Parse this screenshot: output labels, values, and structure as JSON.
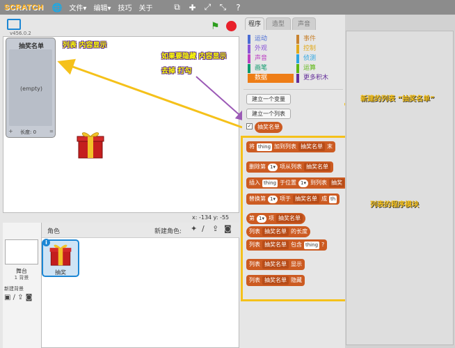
{
  "topbar": {
    "logo": "SCRATCH",
    "menus": [
      "文件▾",
      "编辑▾",
      "技巧",
      "关于"
    ]
  },
  "stage": {
    "version": "v456.0.2",
    "monitor": {
      "title": "抽奖名单",
      "empty": "(empty)",
      "plus": "+",
      "length_label": "长度: 0"
    },
    "coords": "x: -134  y: -55"
  },
  "annotations": {
    "list_content": "列表 内容显示",
    "hide_line1": "如果要隐藏 内容显示",
    "hide_line2": "去掉 打勾",
    "new_list": "新建的列表 “抽奖名单”",
    "list_blocks": "列表的程序模块"
  },
  "sprites": {
    "header_label": "角色",
    "new_sprite_label": "新建角色:",
    "stage_label": "舞台",
    "stage_bg_count": "1 背景",
    "new_backdrop": "新建背景",
    "sprite_name": "抽奖",
    "info": "i"
  },
  "palette": {
    "tabs": [
      "程序",
      "造型",
      "声音"
    ],
    "categories_left": [
      {
        "label": "运动",
        "color": "#4a6cd4"
      },
      {
        "label": "外观",
        "color": "#8a55d7"
      },
      {
        "label": "声音",
        "color": "#bb42c3"
      },
      {
        "label": "画笔",
        "color": "#0e9a6c"
      },
      {
        "label": "数据",
        "color": "#ee7d16"
      }
    ],
    "categories_right": [
      {
        "label": "事件",
        "color": "#c88330"
      },
      {
        "label": "控制",
        "color": "#e1a91a"
      },
      {
        "label": "侦测",
        "color": "#2ca5e2"
      },
      {
        "label": "运算",
        "color": "#5cb712"
      },
      {
        "label": "更多积木",
        "color": "#632d99"
      }
    ],
    "make_variable": "建立一个变量",
    "make_list": "建立一个列表",
    "list_name": "抽奖名单",
    "blocks": {
      "add": {
        "a": "将",
        "b": "thing",
        "c": "加到列表",
        "d": "抽奖名单",
        "e": "末"
      },
      "delete": {
        "a": "删除第",
        "b": "1▾",
        "c": "项从列表",
        "d": "抽奖名单"
      },
      "insert": {
        "a": "插入",
        "b": "thing",
        "c": "于位置",
        "d": "1▾",
        "e": "到列表",
        "f": "抽奖"
      },
      "replace": {
        "a": "替换第",
        "b": "1▾",
        "c": "项于",
        "d": "抽奖名单",
        "e": "成",
        "f": "th"
      },
      "item": {
        "a": "第",
        "b": "1▾",
        "c": "项",
        "d": "抽奖名单"
      },
      "length": {
        "a": "列表",
        "b": "抽奖名单",
        "c": "的长度"
      },
      "contains": {
        "a": "列表",
        "b": "抽奖名单",
        "c": "包含",
        "d": "thing",
        "e": "?"
      },
      "show": {
        "a": "列表",
        "b": "抽奖名单",
        "c": "显示"
      },
      "hide": {
        "a": "列表",
        "b": "抽奖名单",
        "c": "隐藏"
      }
    }
  },
  "colors": {
    "annotation_yellow": "#f5c11a",
    "annotation_purple": "#9b59b6",
    "list_block": "#cc5b22",
    "data_category": "#ee7d16"
  }
}
